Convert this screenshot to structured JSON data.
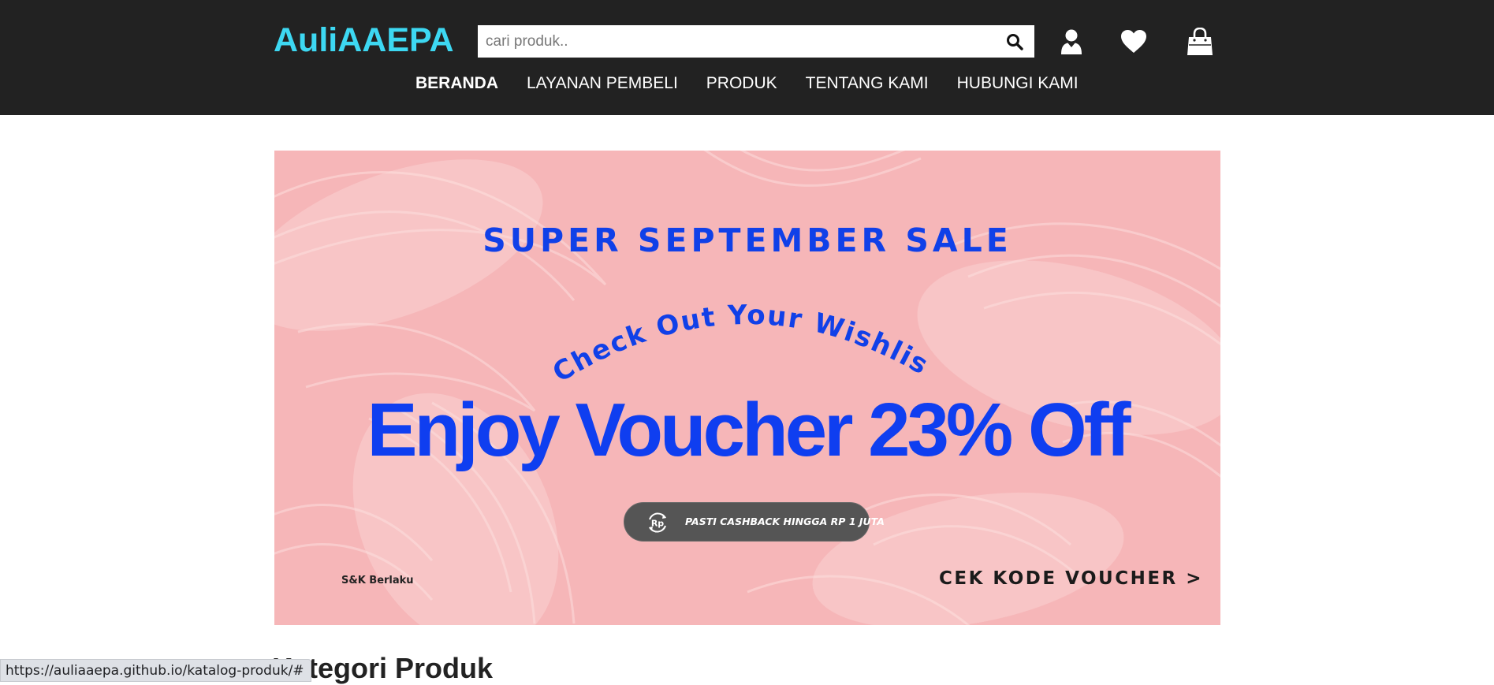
{
  "header": {
    "brand": "AuliAAEPA",
    "search": {
      "placeholder": "cari produk..",
      "value": ""
    },
    "icons": [
      "user-icon",
      "heart-icon",
      "shopping-bag-icon",
      "search-icon"
    ]
  },
  "nav": {
    "items": [
      {
        "label": "BERANDA",
        "active": true
      },
      {
        "label": "LAYANAN PEMBELI",
        "active": false
      },
      {
        "label": "PRODUK",
        "active": false
      },
      {
        "label": "TENTANG KAMI",
        "active": false
      },
      {
        "label": "HUBUNGI KAMI",
        "active": false
      }
    ]
  },
  "banner": {
    "headline": "SUPER SEPTEMBER SALE",
    "arc_text": "Check Out Your Wishlist",
    "offer": "Enjoy Voucher 23% Off",
    "pill_text": "PASTI CASHBACK HINGGA RP 1 JUTA",
    "pill_icon_label": "Rp",
    "terms": "S&K Berlaku",
    "cta": "CEK KODE VOUCHER >"
  },
  "section": {
    "title": "Kategori Produk"
  },
  "status_bar": {
    "url": "https://auliaaepa.github.io/katalog-produk/#"
  },
  "colors": {
    "topbar": "#222222",
    "brand": "#3dd8f2",
    "banner_bg": "#f6b6b8",
    "banner_blue": "#0f3ef0"
  }
}
